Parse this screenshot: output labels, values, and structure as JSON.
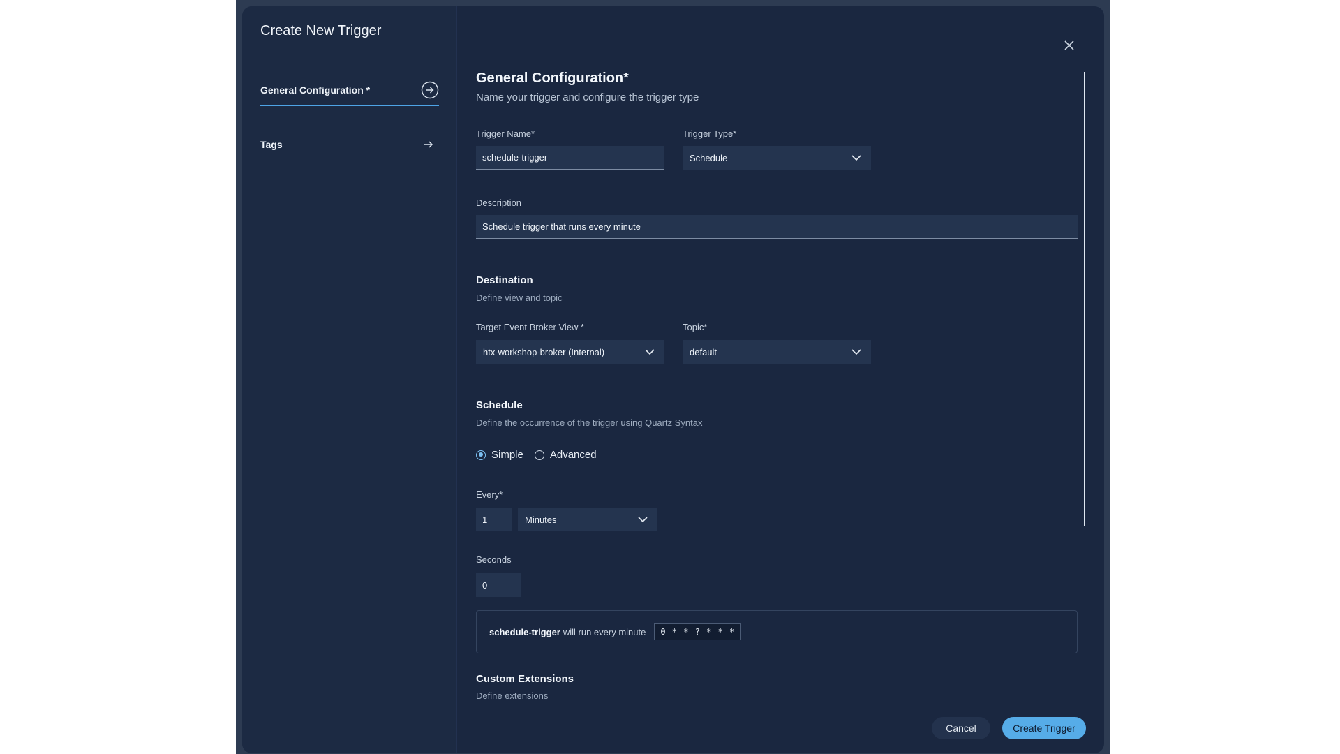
{
  "modal": {
    "title": "Create New Trigger"
  },
  "nav": {
    "items": [
      {
        "label": "General Configuration *",
        "active": true
      },
      {
        "label": "Tags",
        "active": false
      }
    ]
  },
  "general": {
    "title": "General Configuration*",
    "subtitle": "Name your trigger and configure the trigger type",
    "trigger_name_label": "Trigger Name*",
    "trigger_name_value": "schedule-trigger",
    "trigger_type_label": "Trigger Type*",
    "trigger_type_value": "Schedule",
    "description_label": "Description",
    "description_value": "Schedule trigger that runs every minute"
  },
  "destination": {
    "title": "Destination",
    "subtitle": "Define view and topic",
    "view_label": "Target Event Broker View *",
    "view_value": "htx-workshop-broker (Internal)",
    "topic_label": "Topic*",
    "topic_value": "default"
  },
  "schedule": {
    "title": "Schedule",
    "subtitle": "Define the occurrence of the trigger using Quartz Syntax",
    "mode_options": [
      "Simple",
      "Advanced"
    ],
    "selected_mode": "Simple",
    "every_label": "Every*",
    "every_value": "1",
    "unit_value": "Minutes",
    "seconds_label": "Seconds",
    "seconds_value": "0",
    "summary_name": "schedule-trigger",
    "summary_text": "will run every minute",
    "cron": "0 * * ? * * *"
  },
  "extensions": {
    "title": "Custom Extensions",
    "subtitle": "Define extensions"
  },
  "actions": {
    "cancel_label": "Cancel",
    "create_label": "Create Trigger"
  },
  "colors": {
    "accent": "#56ace8",
    "panel": "#1a2740",
    "sidebar": "#1c2a43",
    "input": "#24344f"
  }
}
